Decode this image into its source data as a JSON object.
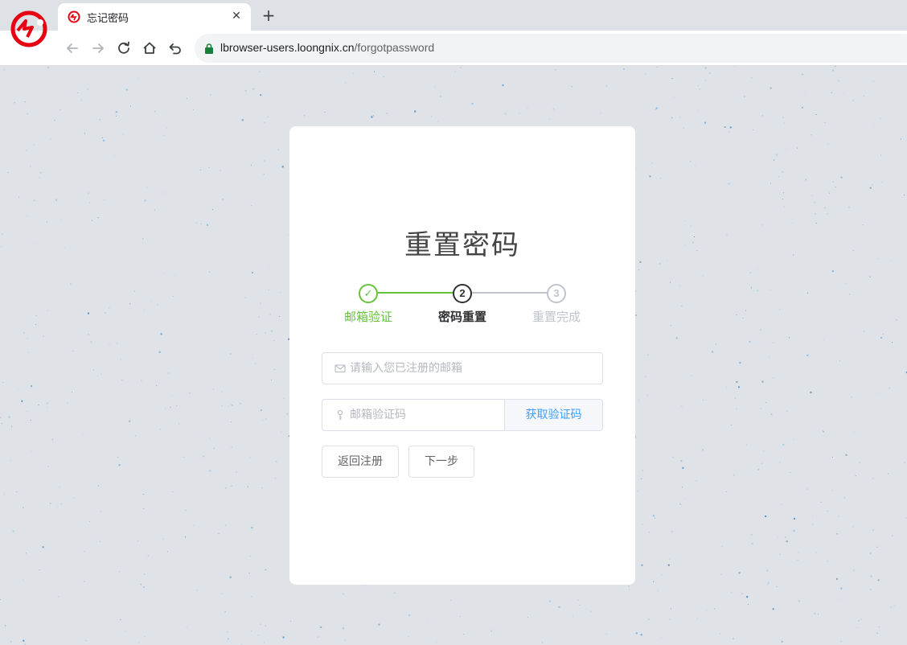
{
  "browser": {
    "tab": {
      "title": "忘记密码"
    },
    "address": {
      "host": "lbrowser-users.loongnix.cn",
      "path": "/forgotpassword"
    }
  },
  "card": {
    "title": "重置密码",
    "steps": [
      {
        "marker": "✓",
        "label": "邮箱验证",
        "state": "done"
      },
      {
        "marker": "2",
        "label": "密码重置",
        "state": "active"
      },
      {
        "marker": "3",
        "label": "重置完成",
        "state": "pending"
      }
    ],
    "email_field": {
      "placeholder": "请输入您已注册的邮箱",
      "value": ""
    },
    "code_field": {
      "placeholder": "邮箱验证码",
      "value": ""
    },
    "get_code_label": "获取验证码",
    "back_label": "返回注册",
    "next_label": "下一步"
  },
  "colors": {
    "done": "#67c23a",
    "active": "#303133",
    "pending": "#c0c4cc",
    "link": "#409eff",
    "brand": "#e60012"
  }
}
